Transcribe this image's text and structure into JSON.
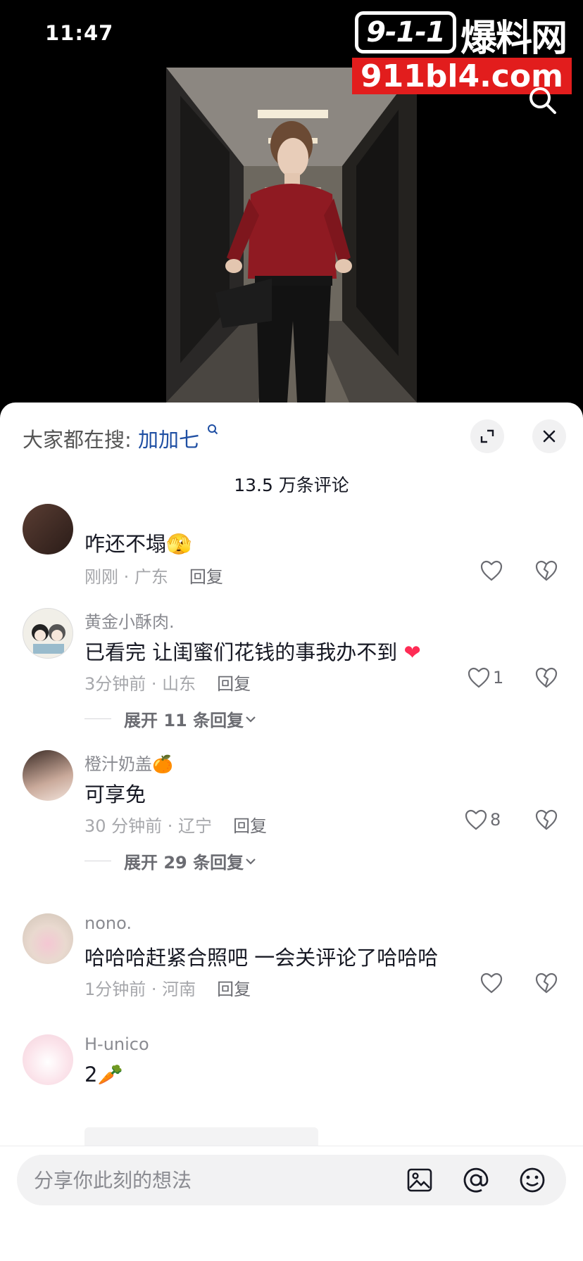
{
  "status": {
    "time": "11:47"
  },
  "watermark": {
    "badge": "9-1-1",
    "title": "爆料网",
    "url": "911bl4.com"
  },
  "sheet": {
    "hot_search_prefix": "大家都在搜:",
    "hot_search_keyword": "加加七",
    "comment_count": "13.5 万条评论"
  },
  "comments": [
    {
      "text": "咋还不塌",
      "emoji": "🫣",
      "meta": "刚刚 · 广东",
      "reply": "回复",
      "likes": ""
    },
    {
      "user": "黄金小酥肉.",
      "text": "已看完 让闺蜜们花钱的事我办不到",
      "emoji": "❤",
      "meta": "3分钟前 · 山东",
      "reply": "回复",
      "likes": "1",
      "expand": "展开 11 条回复"
    },
    {
      "user": "橙汁奶盖",
      "user_emoji": "🍊",
      "text": "可享免",
      "meta": "30 分钟前 · 辽宁",
      "reply": "回复",
      "likes": "8",
      "expand": "展开 29 条回复"
    },
    {
      "user": "nono.",
      "text": "哈哈哈赶紧合照吧 一会关评论了哈哈哈",
      "meta": "1分钟前 · 河南",
      "reply": "回复",
      "likes": ""
    },
    {
      "user": "H-unico",
      "text": "2",
      "emoji": "🥕"
    }
  ],
  "input": {
    "placeholder": "分享你此刻的想法"
  },
  "colors": {
    "accent_link": "#1f4fa3",
    "watermark_red": "#e21d1d",
    "heart_red": "#fe2c55"
  }
}
